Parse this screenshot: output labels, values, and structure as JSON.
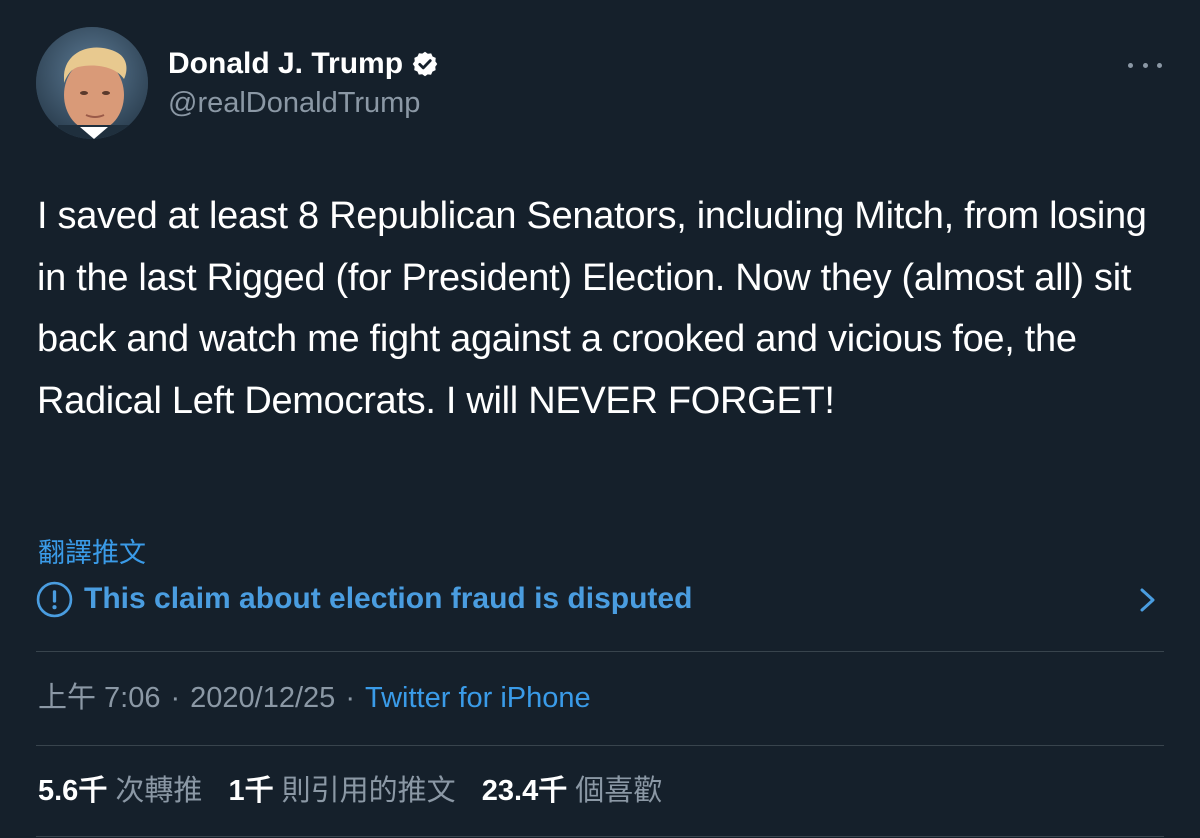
{
  "user": {
    "display_name": "Donald J. Trump",
    "handle": "@realDonaldTrump",
    "verified": true
  },
  "tweet": {
    "text": "I saved at least 8 Republican Senators, including Mitch, from losing in the last Rigged (for President) Election. Now they (almost all) sit back and watch me fight against a crooked and vicious foe, the Radical Left Democrats. I will NEVER FORGET!",
    "translate_label": "翻譯推文",
    "notice": "This claim about election fraud is disputed"
  },
  "meta": {
    "time": "上午 7:06",
    "date": "2020/12/25",
    "separator": "·",
    "source": "Twitter for iPhone"
  },
  "stats": {
    "retweets_count": "5.6千",
    "retweets_label": "次轉推",
    "quotes_count": "1千",
    "quotes_label": "則引用的推文",
    "likes_count": "23.4千",
    "likes_label": "個喜歡"
  },
  "icons": {
    "verified": "verified-badge-icon",
    "more": "more-options-icon",
    "notice": "exclamation-circle-icon",
    "chevron": "chevron-right-icon"
  },
  "colors": {
    "background": "#15202b",
    "link": "#3a9be8",
    "secondary_text": "#8b98a5",
    "divider": "#38444d"
  }
}
